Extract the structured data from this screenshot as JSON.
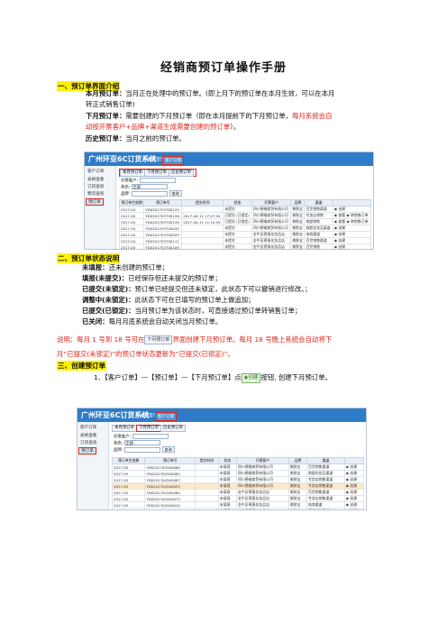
{
  "doc_title": "经销商预订单操作手册",
  "sec1": {
    "heading": "一、预订单界面介绍",
    "l1_label": "本月预订单：",
    "l1_text": "当月正在处理中的预订单。(即上月下的预订单在本月生效，可以在本月",
    "l1_cont": "转正式销售订单)",
    "l2_label": "下月预订单：",
    "l2_text": "需要创建的下月预订单（即在本月提前下的下月预订单，",
    "l2_red": "每月系统会自",
    "l2_cont_red": "动按开票客户+品牌+渠道生成需要创建的预订单",
    "l2_cont": "）。",
    "l3_label": "历史预订单：",
    "l3_text": "当月之前的预订单。"
  },
  "shot1": {
    "brand": "广州环亚6C订货系统",
    "nav": [
      "系统首页",
      "客户订单"
    ],
    "side": [
      "客户订单",
      "表格查看",
      "订货查询",
      "物流查询",
      "预订单"
    ],
    "tabs": [
      "本月预订单",
      "下月预订单",
      "历史预订单"
    ],
    "form_labels": [
      "开票客户:",
      "状态:",
      "品牌:"
    ],
    "form_values": [
      "",
      "全部",
      ""
    ],
    "query_label": "查询",
    "columns": [
      "预订单生效期",
      "预订单号",
      "提交时间",
      "状态",
      "开票客户",
      "品牌",
      "渠道",
      ""
    ],
    "rows": [
      [
        "2017-04",
        "YD0201703700125",
        "",
        "未提交",
        "四川德福商贸有限公司",
        "美肤宝",
        "百货销售渠道",
        "◉ 创建"
      ],
      [
        "2017-04",
        "YD0201703700126",
        "2017-04-11 17:07:54",
        "已提交 (已锁定)",
        "四川德福商贸有限公司",
        "美肤宝",
        "专卖店销售",
        "◉ 查看 ◉ 转销售订单"
      ],
      [
        "2017-04",
        "YD0201703700128",
        "2017-04-11 11:10:55",
        "已提交 (已锁定)",
        "四川德福商贸有限公司",
        "美肤宝",
        "商超销售",
        "◉ 查看 ◉ 转销售订单"
      ],
      [
        "2017-04",
        "YD0201703700035",
        "",
        "未提交",
        "四川德福商贸有限公司",
        "美肤宝",
        "商超化妆品渠道",
        "◉ 创建"
      ],
      [
        "2017-04",
        "YD0201703700029",
        "",
        "未提交",
        "金牛区德惠化妆品店",
        "美肤宝",
        "电商渠道",
        "◉ 创建"
      ],
      [
        "2017-04",
        "YD0201703700111",
        "",
        "未提交",
        "金牛区德惠化妆品店",
        "美肤宝",
        "百货销售渠道",
        "◉ 创建"
      ],
      [
        "2017-04",
        "YD0201703700109",
        "",
        "未提交",
        "金牛区德惠化妆品店",
        "美肤宝",
        "百货销售",
        "◉ 创建"
      ],
      [
        "2017-04",
        "YD0201703700136",
        "2017-04-13 15:47:38",
        "已提交 (已锁定)",
        "金牛区德惠化妆品店",
        "美肤宝",
        "专卖店销售",
        "◉ 查看 ◉ 转销售订单"
      ]
    ]
  },
  "sec2": {
    "heading": "二、预订单状态说明",
    "items": [
      {
        "label": "未填报：",
        "text": "还未创建的预订单；"
      },
      {
        "label": "填报(未提交)：",
        "text": "已经保存但还未提交的预订单；"
      },
      {
        "label": "已提交(未锁定)：",
        "text": "预订单已经提交但还未锁定，此状态下可以撤销进行修改。；"
      },
      {
        "label": "调整中(未锁定)：",
        "text": "此状态下可在已填写的预订单上做追加；"
      },
      {
        "label": "已提交(已锁定)：",
        "text": "当月预订单为该状态时，可直接通过预订单转销售订单；"
      },
      {
        "label": "已关闭：",
        "text": "每月月底系统会自动关闭当月预订单。"
      }
    ],
    "note_a": "说明：每月 1 号到 18 号可在",
    "note_btn": "下月预订单",
    "note_b": "界面创建下月预订单。每月 18 号晚上系统会自动将下",
    "note_c": "月“已提交(未锁定)”的预订单状态更新为“已提交(已锁定)”。"
  },
  "sec3": {
    "heading": "三、创建预订单",
    "step_a": "1、【客户订单】—【预订单】—【下月预订单】点",
    "step_btn": "◉创建",
    "step_b": "按钮, 创建下月预订单。"
  },
  "shot2": {
    "brand": "广州环亚6C订货系统",
    "nav": [
      "系统首页",
      "客户订单"
    ],
    "side": [
      "客户订单",
      "表格查看",
      "订货查询",
      "预订单"
    ],
    "tabs": [
      "本月预订单",
      "下月预订单",
      "历史预订单"
    ],
    "form_labels": [
      "开票客户:",
      "状态:",
      "品牌:"
    ],
    "form_values": [
      "",
      "全部",
      ""
    ],
    "query_label": "查询",
    "columns": [
      "预订单生效期",
      "预订单号",
      "提交时间",
      "状态",
      "开票客户",
      "品牌",
      "渠道",
      ""
    ],
    "rows": [
      [
        "2017-05",
        "YD0201704300080",
        "",
        "未填报",
        "四川德福商贸有限公司",
        "美肤宝",
        "百货销售渠道",
        "◉ 创建"
      ],
      [
        "2017-05",
        "YD0201704300082",
        "",
        "未填报",
        "四川德福商贸有限公司",
        "美肤宝",
        "商超化妆品渠道",
        "◉ 创建"
      ],
      [
        "2017-05",
        "YD0201704300087",
        "",
        "未填报",
        "四川德福商贸有限公司",
        "美肤宝",
        "专卖店销售渠道",
        "◉ 创建"
      ],
      [
        "2017-05",
        "YD0201704300053",
        "",
        "未填报",
        "四川德福商贸有限公司",
        "美肤宝",
        "专卖店销售渠道",
        "◉ 创建"
      ],
      [
        "2017-05",
        "YD0201704300084",
        "",
        "未填报",
        "金牛区德惠化妆品店",
        "美肤宝",
        "百货销售渠道",
        "◉ 创建"
      ],
      [
        "2017-05",
        "YD0201704300073",
        "",
        "未填报",
        "金牛区德惠化妆品店",
        "美肤宝",
        "专卖店销售渠道",
        "◉ 创建"
      ],
      [
        "2017-05",
        "YD0201704300010",
        "",
        "未填报",
        "金牛区德惠化妆品店",
        "美肤宝",
        "电商渠道",
        "◉ 创建"
      ],
      [
        "2017-05",
        "YD0201704300070",
        "",
        "未填报",
        "金牛区德惠化妆品店",
        "美肤宝",
        "百货销售渠道",
        "◉ 创建"
      ]
    ]
  },
  "colors": {
    "accent_red": "#e0251b",
    "highlight_yellow": "#fff200",
    "header_blue": "#2e7cc7"
  }
}
